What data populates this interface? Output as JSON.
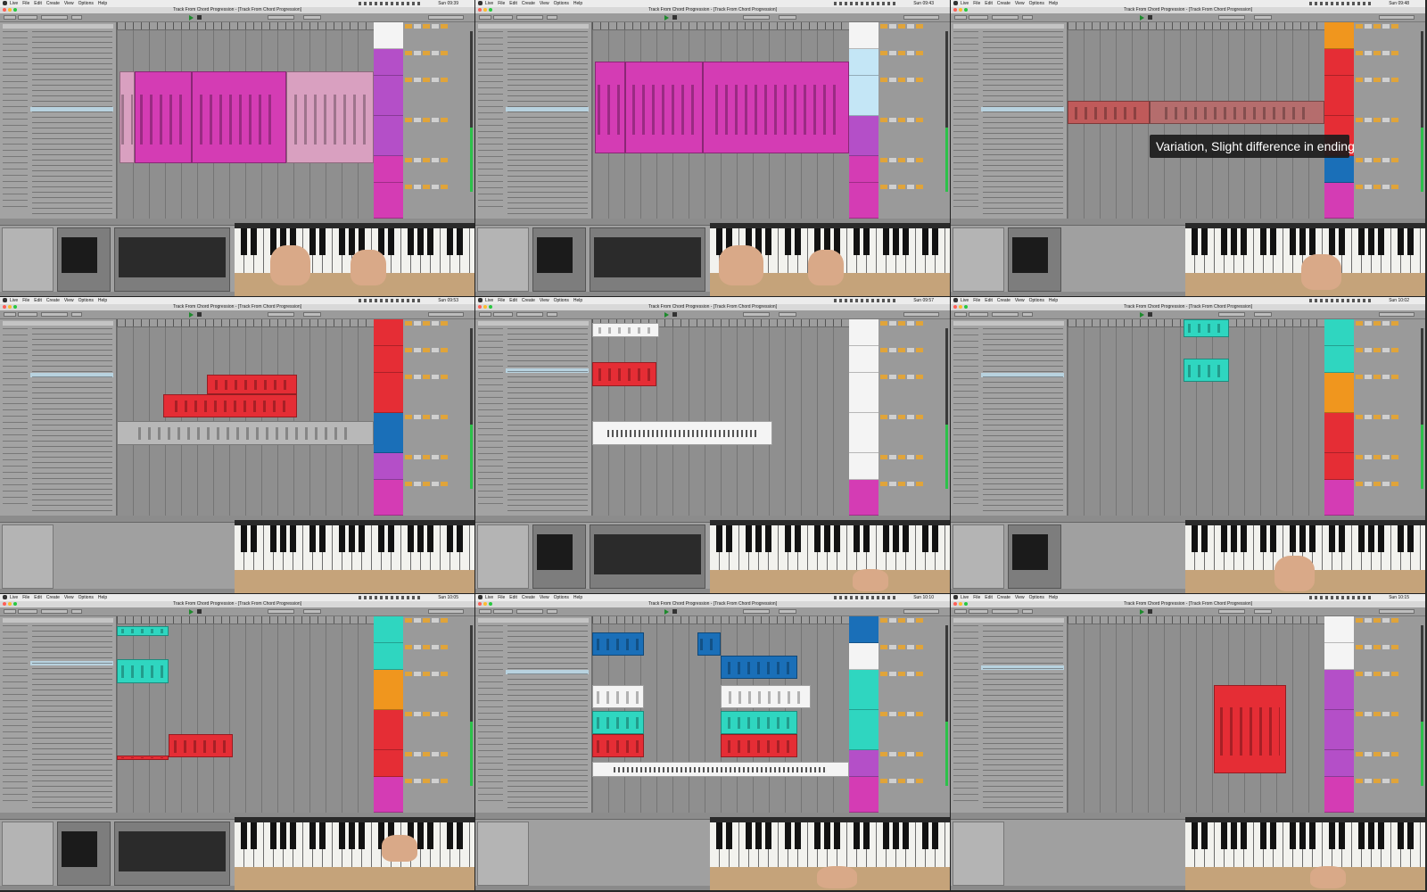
{
  "menubar": {
    "items": [
      "Live",
      "File",
      "Edit",
      "Create",
      "View",
      "Options",
      "Help"
    ]
  },
  "window_title": "Track From Chord Progression - [Track From Chord Progression]",
  "caption": "Variation, Slight difference in ending",
  "panels": [
    {
      "clock": "Sun 09:39",
      "accent": "#d43cb4"
    },
    {
      "clock": "Sun 09:43",
      "accent": "#d43cb4"
    },
    {
      "clock": "Sun 09:48",
      "accent": "#e52d35"
    },
    {
      "clock": "Sun 09:53",
      "accent": "#e52d35"
    },
    {
      "clock": "Sun 09:57",
      "accent": "#e52d35"
    },
    {
      "clock": "Sun 10:02",
      "accent": "#2fd6c0"
    },
    {
      "clock": "Sun 10:05",
      "accent": "#2fd6c0"
    },
    {
      "clock": "Sun 10:10",
      "accent": "#1a6fb8"
    },
    {
      "clock": "Sun 10:15",
      "accent": "#e24a4a"
    }
  ],
  "colors": {
    "magenta": "#d43cb4",
    "pink_region": "#d9a0c0",
    "red": "#e52d35",
    "cyan": "#2fd6c0",
    "blue": "#1a6fb8",
    "orange": "#f0961e",
    "purple": "#b44fc8",
    "light_blue": "#c4e6f6",
    "white": "#f4f4f4",
    "track_grey": "#9a9a9a"
  }
}
